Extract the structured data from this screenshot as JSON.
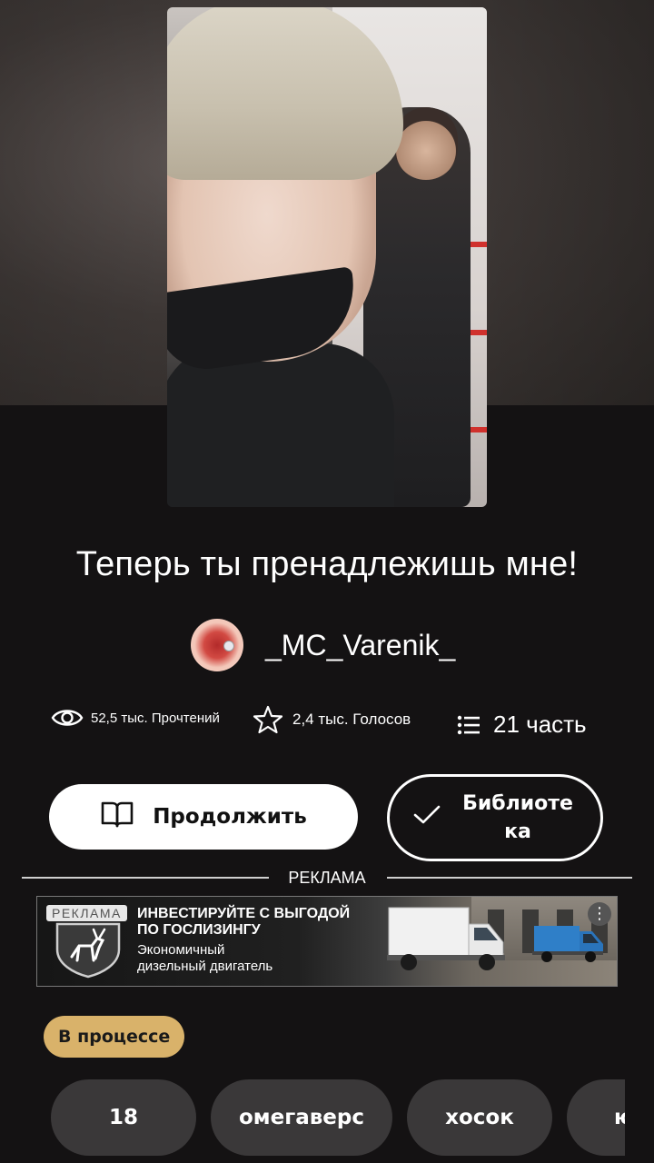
{
  "story": {
    "title": "Теперь ты пренадлежишь мне!",
    "author": "_MC_Varenik_",
    "stats": {
      "reads": "52,5 тыс. Прочтений",
      "votes": "2,4 тыс. Голосов",
      "parts": "21 часть"
    },
    "status": "В процессе"
  },
  "actions": {
    "continue_label": "Продолжить",
    "library_label": "Библиотека"
  },
  "ad": {
    "divider_label": "РЕКЛАМА",
    "badge": "РЕКЛАМА",
    "headline_1": "ИНВЕСТИРУЙТЕ С ВЫГОДОЙ",
    "headline_2": "ПО ГОСЛИЗИНГУ",
    "body_1": "Экономичный",
    "body_2": "дизельный двигатель",
    "menu_glyph": "⋮"
  },
  "tags": [
    "18",
    "омегаверс",
    "хосок",
    "ю"
  ],
  "colors": {
    "background": "#141213",
    "status_badge": "#d9b26a",
    "tag_bg": "#3a3839"
  },
  "icons": [
    "eye-icon",
    "star-icon",
    "list-icon",
    "book-icon",
    "check-icon",
    "gaz-deer-logo-icon"
  ]
}
